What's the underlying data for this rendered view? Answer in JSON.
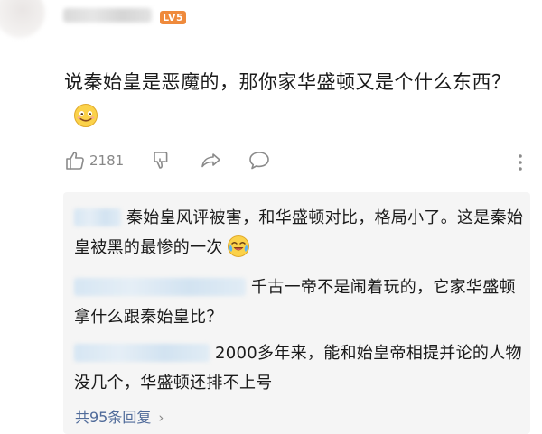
{
  "header": {
    "level_badge": "LV5"
  },
  "comment": {
    "text": "说秦始皇是恶魔的，那你家华盛顿又是个什么东西？",
    "emoji": "smile-emoji"
  },
  "actions": {
    "like_count": "2181",
    "icons": [
      "thumbs-up-icon",
      "thumbs-down-icon",
      "share-icon",
      "comment-icon",
      "more-icon"
    ]
  },
  "replies": {
    "items": [
      {
        "text": "秦始皇风评被害，和华盛顿对比，格局小了。这是秦始皇被黑的最惨的一次",
        "emoji": "crying-laugh-emoji"
      },
      {
        "text": "千古一帝不是闹着玩的，它家华盛顿拿什么跟秦始皇比？"
      },
      {
        "text": "2000多年来，能和始皇帝相提并论的人物没几个，华盛顿还排不上号"
      }
    ],
    "view_more": "共95条回复"
  },
  "colors": {
    "badge": "#ef8a3c",
    "link": "#506b9a",
    "reply_bg": "#f5f5f5"
  }
}
